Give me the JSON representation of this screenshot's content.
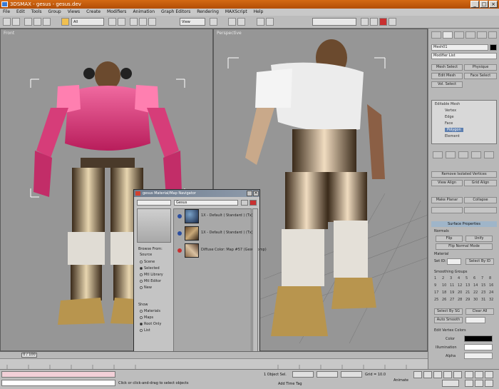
{
  "app": {
    "title": "3DSMAX - gesus - gesus.dev"
  },
  "menu": [
    "File",
    "Edit",
    "Tools",
    "Group",
    "Views",
    "Create",
    "Modifiers",
    "Animation",
    "Graph Editors",
    "Rendering",
    "MAXScript",
    "Help"
  ],
  "toolbar": {
    "selection_filter": "All",
    "view_dropdown": "View"
  },
  "viewports": {
    "front_label": "Front",
    "perspective_label": "Perspective"
  },
  "command_panel": {
    "object_name": "Mesh01",
    "modifier_list": "Modifier List",
    "buttons": [
      "Mesh Select",
      "Physique",
      "Edit Mesh",
      "Face Select",
      "Vol. Select"
    ],
    "stack_items": [
      "Editable Mesh",
      "Vertex",
      "Edge",
      "Face",
      "Polygon",
      "Element"
    ],
    "rollouts": [
      "Surface Properties",
      "Smoothing Groups"
    ],
    "edit_buttons": [
      "Remove Isolated Vertices",
      "View Align",
      "Grid Align",
      "Make Planar",
      "Collapse",
      "Flip",
      "Unify",
      "Flip Normal Mode"
    ],
    "sections": {
      "normals": "Normals",
      "material": "Material",
      "set_id": "Set ID:",
      "select_by_id": "Select By ID",
      "select_by_sg": "Select By SG",
      "clear_all": "Clear All",
      "auto_smooth": "Auto Smooth",
      "edit_vertex_colors": "Edit Vertex Colors",
      "color": "Color",
      "illumination": "Illumination",
      "alpha": "Alpha"
    },
    "sg_numbers": [
      "1",
      "2",
      "3",
      "4",
      "5",
      "6",
      "7",
      "8",
      "9",
      "10",
      "11",
      "12",
      "13",
      "14",
      "15",
      "16",
      "17",
      "18",
      "19",
      "20",
      "21",
      "22",
      "23",
      "24",
      "25",
      "26",
      "27",
      "28",
      "29",
      "30",
      "31",
      "32"
    ]
  },
  "material_dialog": {
    "title": "gesus Material/Map Navigator",
    "name_field": "Gesus",
    "browse_from": "Browse From:",
    "source_options": [
      "Scene",
      "Selected",
      "Mtl Library",
      "Mtl Editor",
      "New"
    ],
    "show_label": "Show",
    "show_options": [
      "Materials",
      "Maps",
      "Root Only",
      "List"
    ],
    "materials": [
      "1X - Default ( Standard ) (Tx)",
      "1X - Default ( Standard ) (Tx)",
      "Diffuse Color: Map #57 (Gesus.bmp)"
    ]
  },
  "timeline": {
    "frame": "0 / 100"
  },
  "status": {
    "prompt": "Click or click-and-drag to select objects",
    "selected": "1 Object Sel.",
    "grid": "Grid = 10.0",
    "add_time_tag": "Add Time Tag",
    "animate": "Animate"
  }
}
